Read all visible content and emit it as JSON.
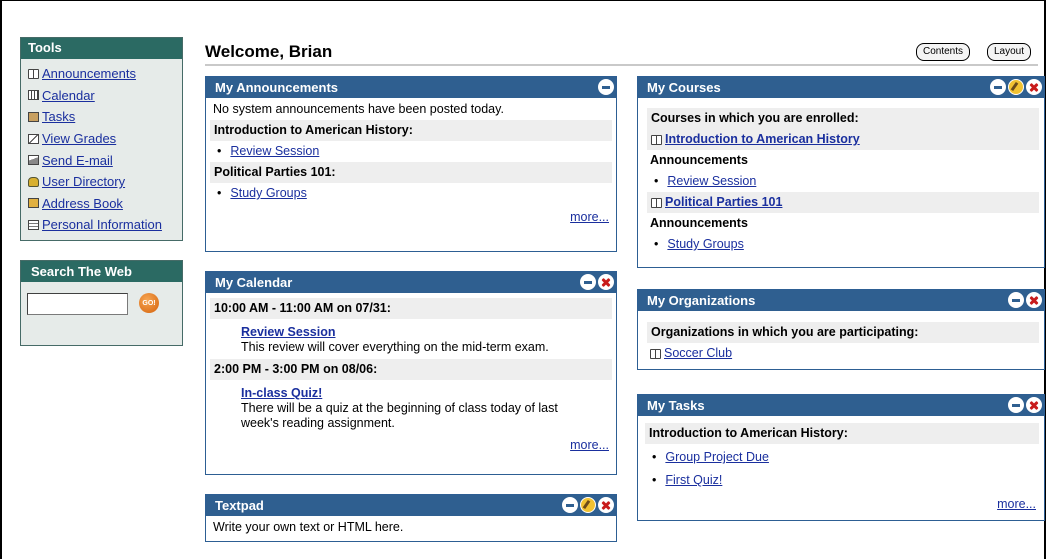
{
  "tools": {
    "title": "Tools",
    "items": [
      {
        "label": "Announcements",
        "icon": "book-icon"
      },
      {
        "label": "Calendar",
        "icon": "calendar-icon"
      },
      {
        "label": "Tasks",
        "icon": "tasks-icon"
      },
      {
        "label": "View Grades",
        "icon": "grades-icon"
      },
      {
        "label": "Send E-mail",
        "icon": "email-icon"
      },
      {
        "label": "User Directory",
        "icon": "user-directory-icon"
      },
      {
        "label": "Address Book",
        "icon": "address-book-icon"
      },
      {
        "label": "Personal Information",
        "icon": "personal-info-icon"
      }
    ]
  },
  "search": {
    "title": "Search The Web",
    "input_value": "",
    "go_label": "GO!"
  },
  "header": {
    "welcome": "Welcome, Brian",
    "contents_label": "Contents",
    "layout_label": "Layout"
  },
  "announcements": {
    "title": "My Announcements",
    "system_text": "No system announcements have been posted today.",
    "course1": "Introduction to American History:",
    "course1_item": "Review Session",
    "course2": "Political Parties 101:",
    "course2_item": "Study Groups",
    "more": "more..."
  },
  "calendar": {
    "title": "My Calendar",
    "event1_time": "10:00 AM - 11:00 AM on 07/31:",
    "event1_title": "Review Session",
    "event1_desc": "This review will cover everything on the mid-term exam.",
    "event2_time": "2:00 PM - 3:00 PM on 08/06:",
    "event2_title": "In-class Quiz!",
    "event2_desc": "There will be a quiz at the beginning of class today of last week's reading assignment.",
    "more": "more..."
  },
  "textpad": {
    "title": "Textpad",
    "text": "Write your own text or HTML here."
  },
  "courses": {
    "title": "My Courses",
    "subtitle": "Courses in which you are enrolled:",
    "course1": "Introduction to American History",
    "announcements_label": "Announcements",
    "course1_item": "Review Session",
    "course2": "Political Parties 101",
    "course2_item": "Study Groups"
  },
  "organizations": {
    "title": "My Organizations",
    "subtitle": "Organizations in which you are participating:",
    "org1": "Soccer Club"
  },
  "tasks": {
    "title": "My Tasks",
    "course1": "Introduction to American History:",
    "items": [
      "Group Project Due",
      "First Quiz!"
    ],
    "more": "more..."
  }
}
